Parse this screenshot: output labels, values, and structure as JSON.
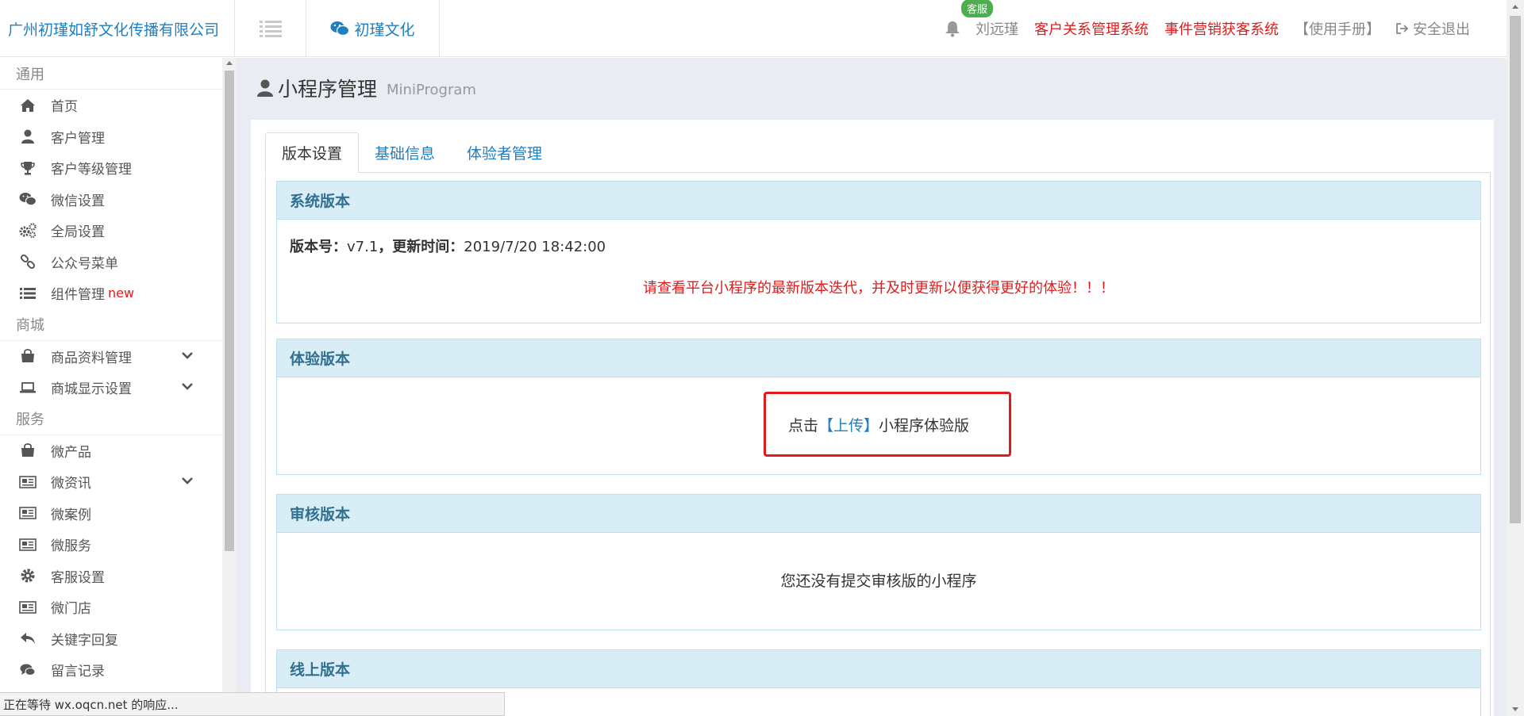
{
  "header": {
    "brand": "广州初瑾如舒文化传播有限公司",
    "site_name": "初瑾文化",
    "badge": "客服",
    "user": "刘远瑾",
    "links": [
      "客户关系管理系统",
      "事件营销获客系统"
    ],
    "manual": "【使用手册】",
    "logout": "安全退出"
  },
  "sidebar": {
    "sections": [
      {
        "title": "通用",
        "items": [
          {
            "label": "首页",
            "icon": "home-icon"
          },
          {
            "label": "客户管理",
            "icon": "user-icon"
          },
          {
            "label": "客户等级管理",
            "icon": "trophy-icon"
          },
          {
            "label": "微信设置",
            "icon": "wechat-icon"
          },
          {
            "label": "全局设置",
            "icon": "gears-icon"
          },
          {
            "label": "公众号菜单",
            "icon": "link-icon"
          },
          {
            "label": "组件管理",
            "icon": "list-icon",
            "tag": "new"
          }
        ]
      },
      {
        "title": "商城",
        "items": [
          {
            "label": "商品资料管理",
            "icon": "shopping-bag-icon"
          },
          {
            "label": "商城显示设置",
            "icon": "laptop-icon"
          }
        ]
      },
      {
        "title": "服务",
        "items": [
          {
            "label": "微产品",
            "icon": "shopping-bag-icon"
          },
          {
            "label": "微资讯",
            "icon": "newspaper-icon"
          },
          {
            "label": "微案例",
            "icon": "newspaper-icon"
          },
          {
            "label": "微服务",
            "icon": "newspaper-icon"
          },
          {
            "label": "客服设置",
            "icon": "gear-icon"
          },
          {
            "label": "微门店",
            "icon": "newspaper-icon"
          },
          {
            "label": "关键字回复",
            "icon": "reply-icon"
          },
          {
            "label": "留言记录",
            "icon": "comments-icon"
          }
        ]
      }
    ]
  },
  "page": {
    "title": "小程序管理",
    "subtitle": "MiniProgram"
  },
  "tabs": [
    "版本设置",
    "基础信息",
    "体验者管理"
  ],
  "panels": {
    "system": {
      "title": "系统版本",
      "version_label": "版本号：",
      "version": "v7.1",
      "time_label": "，更新时间：",
      "time": "2019/7/20 18:42:00",
      "notice": "请查看平台小程序的最新版本迭代，并及时更新以便获得更好的体验！！！"
    },
    "trial": {
      "title": "体验版本",
      "prefix": "点击",
      "link": "【上传】",
      "suffix": "小程序体验版"
    },
    "review": {
      "title": "审核版本",
      "text": "您还没有提交审核版的小程序"
    },
    "online": {
      "title": "线上版本"
    }
  },
  "status": "正在等待 wx.oqcn.net 的响应..."
}
